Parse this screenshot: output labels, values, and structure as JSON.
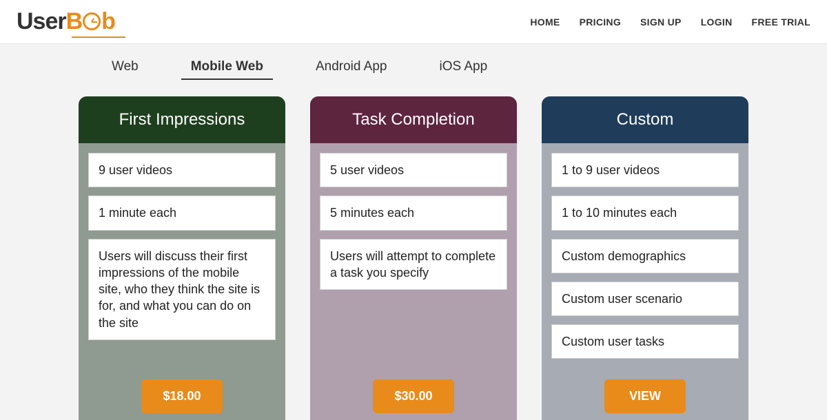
{
  "logo": {
    "part1": "User",
    "part2_b": "B",
    "part2_end": "b"
  },
  "nav": {
    "home": "HOME",
    "pricing": "PRICING",
    "signup": "SIGN UP",
    "login": "LOGIN",
    "trial": "FREE TRIAL"
  },
  "tabs": {
    "web": "Web",
    "mobile_web": "Mobile Web",
    "android": "Android App",
    "ios": "iOS App"
  },
  "plans": {
    "first": {
      "title": "First Impressions",
      "f1": "9 user videos",
      "f2": "1 minute each",
      "f3": "Users will discuss their first impressions of the mobile site, who they think the site is for, and what you can do on the site",
      "price": "$18.00"
    },
    "task": {
      "title": "Task Completion",
      "f1": "5 user videos",
      "f2": "5 minutes each",
      "f3": "Users will attempt to complete a task you specify",
      "price": "$30.00"
    },
    "custom": {
      "title": "Custom",
      "f1": "1 to 9 user videos",
      "f2": "1 to 10 minutes each",
      "f3": "Custom demographics",
      "f4": "Custom user scenario",
      "f5": "Custom user tasks",
      "price": "VIEW"
    }
  }
}
